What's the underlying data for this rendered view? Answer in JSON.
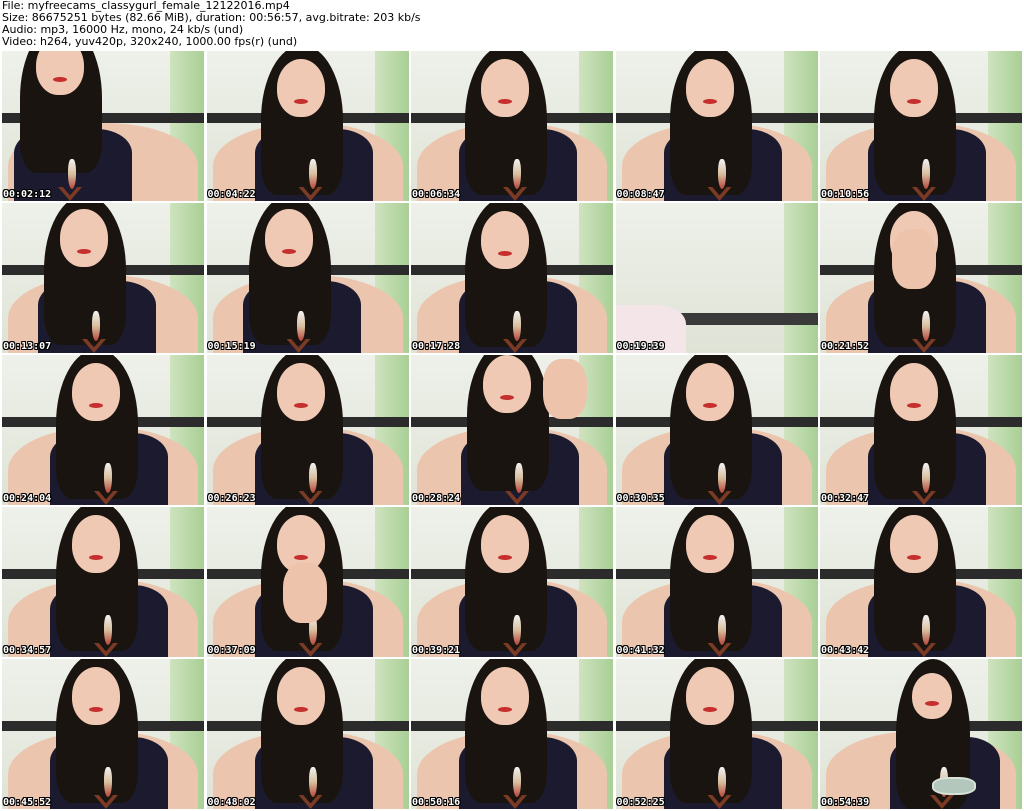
{
  "header": {
    "file_line": "File: myfreecams_classygurl_female_12122016.mp4",
    "size_line": "Size: 86675251 bytes (82.66 MiB), duration: 00:56:57, avg.bitrate: 203 kb/s",
    "audio_line": "Audio: mp3, 16000 Hz, mono, 24 kb/s (und)",
    "video_line": "Video: h264, yuv420p, 320x240, 1000.00 fps(r) (und)"
  },
  "thumbnails": [
    {
      "timestamp": "00:02:12",
      "variant": "lean"
    },
    {
      "timestamp": "00:04:22",
      "variant": "center"
    },
    {
      "timestamp": "00:06:34",
      "variant": "center"
    },
    {
      "timestamp": "00:08:47",
      "variant": "center"
    },
    {
      "timestamp": "00:10:56",
      "variant": "center"
    },
    {
      "timestamp": "00:13:07",
      "variant": "hair"
    },
    {
      "timestamp": "00:15:19",
      "variant": "hair"
    },
    {
      "timestamp": "00:17:28",
      "variant": "center"
    },
    {
      "timestamp": "00:19:39",
      "variant": "empty"
    },
    {
      "timestamp": "00:21:52",
      "variant": "hand"
    },
    {
      "timestamp": "00:24:04",
      "variant": "center"
    },
    {
      "timestamp": "00:26:23",
      "variant": "center"
    },
    {
      "timestamp": "00:28:24",
      "variant": "turn"
    },
    {
      "timestamp": "00:30:35",
      "variant": "center"
    },
    {
      "timestamp": "00:32:47",
      "variant": "center"
    },
    {
      "timestamp": "00:34:57",
      "variant": "center"
    },
    {
      "timestamp": "00:37:09",
      "variant": "chin"
    },
    {
      "timestamp": "00:39:21",
      "variant": "center"
    },
    {
      "timestamp": "00:41:32",
      "variant": "center"
    },
    {
      "timestamp": "00:43:42",
      "variant": "center"
    },
    {
      "timestamp": "00:45:52",
      "variant": "center"
    },
    {
      "timestamp": "00:48:02",
      "variant": "center"
    },
    {
      "timestamp": "00:50:16",
      "variant": "center"
    },
    {
      "timestamp": "00:52:25",
      "variant": "center"
    },
    {
      "timestamp": "00:54:39",
      "variant": "glasses"
    }
  ]
}
